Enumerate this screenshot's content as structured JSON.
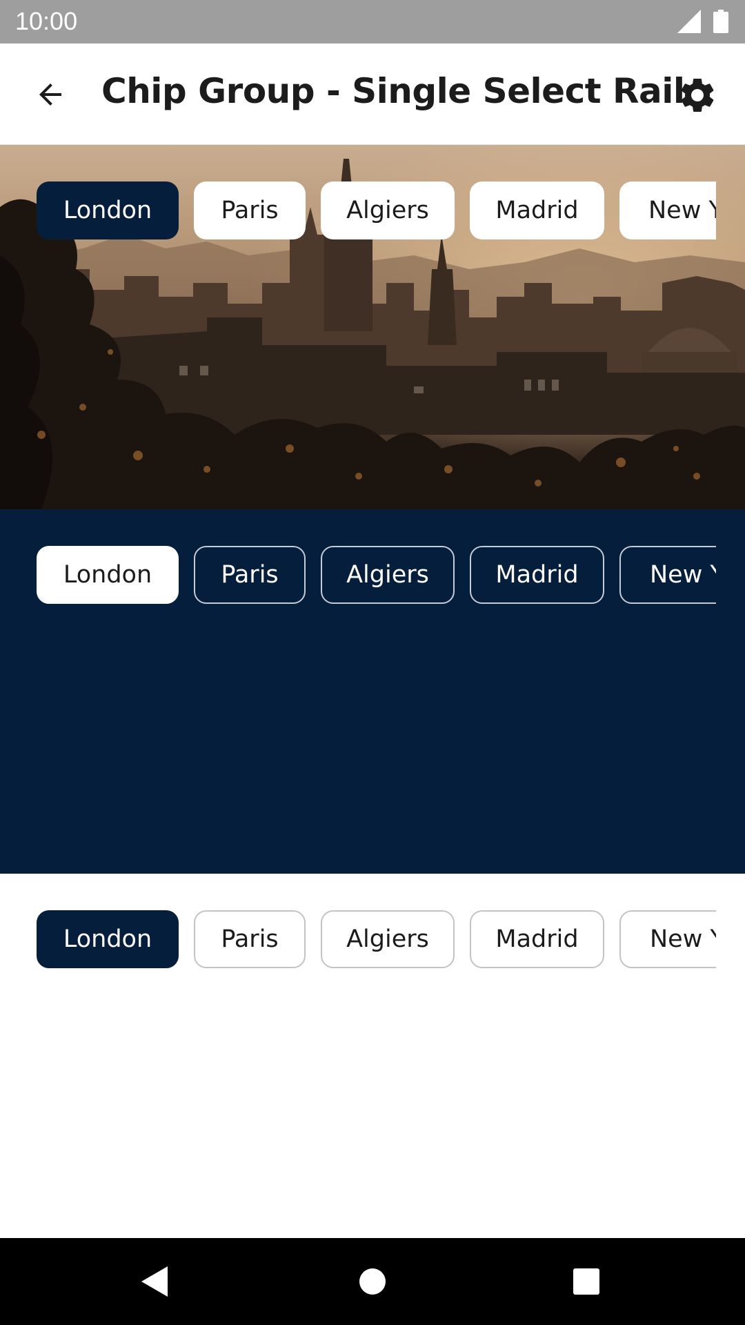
{
  "status_bar": {
    "time": "10:00",
    "icons": [
      "cellular-signal-icon",
      "battery-icon"
    ]
  },
  "app_bar": {
    "title": "Chip Group - Single Select Rail",
    "back_icon": "arrow-back-icon",
    "settings_icon": "gear-icon"
  },
  "rails": {
    "photo": {
      "background": "city-skyline-photo",
      "selected": "London",
      "chips": [
        {
          "label": "London",
          "selected": true
        },
        {
          "label": "Paris",
          "selected": false
        },
        {
          "label": "Algiers",
          "selected": false
        },
        {
          "label": "Madrid",
          "selected": false
        },
        {
          "label": "New York",
          "selected": false
        }
      ]
    },
    "dark": {
      "background_color": "#051e3c",
      "selected": "London",
      "chips": [
        {
          "label": "London",
          "selected": true
        },
        {
          "label": "Paris",
          "selected": false
        },
        {
          "label": "Algiers",
          "selected": false
        },
        {
          "label": "Madrid",
          "selected": false
        },
        {
          "label": "New York",
          "selected": false
        }
      ]
    },
    "light": {
      "background_color": "#ffffff",
      "selected": "London",
      "chips": [
        {
          "label": "London",
          "selected": true
        },
        {
          "label": "Paris",
          "selected": false
        },
        {
          "label": "Algiers",
          "selected": false
        },
        {
          "label": "Madrid",
          "selected": false
        },
        {
          "label": "New York",
          "selected": false
        }
      ]
    }
  },
  "colors": {
    "accent_navy": "#051e3c",
    "status_bar": "#9e9e9e",
    "nav_bar": "#000000"
  },
  "nav_bar": {
    "icons": [
      "nav-back-icon",
      "nav-home-icon",
      "nav-recents-icon"
    ]
  }
}
